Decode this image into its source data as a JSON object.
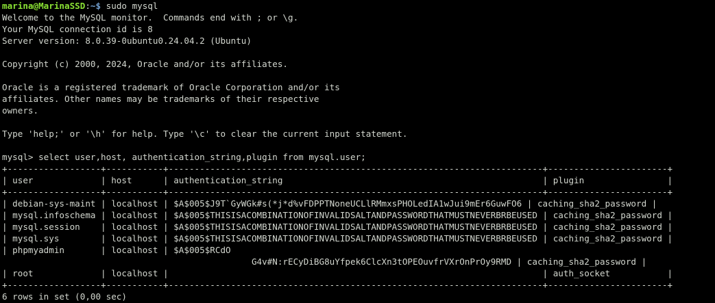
{
  "prompt": {
    "user_host": "marina@MarinaSSD",
    "separator": ":",
    "path_symbol": "~$",
    "command": " sudo mysql"
  },
  "banner": [
    "Welcome to the MySQL monitor.  Commands end with ; or \\g.",
    "Your MySQL connection id is 8",
    "Server version: 8.0.39-0ubuntu0.24.04.2 (Ubuntu)",
    "",
    "Copyright (c) 2000, 2024, Oracle and/or its affiliates.",
    "",
    "Oracle is a registered trademark of Oracle Corporation and/or its",
    "affiliates. Other names may be trademarks of their respective",
    "owners.",
    "",
    "Type 'help;' or '\\h' for help. Type '\\c' to clear the current input statement.",
    ""
  ],
  "query": "mysql> select user,host, authentication_string,plugin from mysql.user;",
  "result_lines": [
    "+------------------+-----------+------------------------------------------------------------------------+-----------------------+",
    "| user             | host      | authentication_string                                                  | plugin                |",
    "+------------------+-----------+------------------------------------------------------------------------+-----------------------+",
    "| debian-sys-maint | localhost | $A$005$J9T`GyWGk#s(*j*d%vFDPPTNoneUCLlRMmxsPHOLedIA1wJui9mEr6GuwFO6 | caching_sha2_password |",
    "| mysql.infoschema | localhost | $A$005$THISISACOMBINATIONOFINVALIDSALTANDPASSWORDTHATMUSTNEVERBRBEUSED | caching_sha2_password |",
    "| mysql.session    | localhost | $A$005$THISISACOMBINATIONOFINVALIDSALTANDPASSWORDTHATMUSTNEVERBRBEUSED | caching_sha2_password |",
    "| mysql.sys        | localhost | $A$005$THISISACOMBINATIONOFINVALIDSALTANDPASSWORDTHATMUSTNEVERBRBEUSED | caching_sha2_password |",
    "| phpmyadmin       | localhost | $A$005$RCdO",
    "                                                G4v#N:rECyDiBG8uYfpek6ClcXn3tOPEOuvfrVXrOnPrOy9RMD | caching_sha2_password |",
    "| root             | localhost |                                                                        | auth_socket           |",
    "+------------------+-----------+------------------------------------------------------------------------+-----------------------+",
    "6 rows in set (0,00 sec)"
  ],
  "next_prompt": "",
  "colors": {
    "background": "#000000",
    "text": "#d3d7cf",
    "prompt_user": "#8ae234",
    "prompt_path": "#729fcf"
  }
}
